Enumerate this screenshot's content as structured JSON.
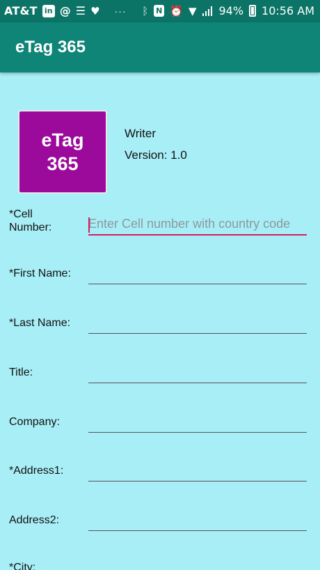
{
  "status_bar": {
    "carrier": "AT&T",
    "notification_icons": [
      "linkedin-icon",
      "at-sign-icon",
      "news-icon",
      "iheart-icon"
    ],
    "overflow": "···",
    "battery": "94%",
    "time": "10:56 AM",
    "system_icons": [
      "bluetooth-icon",
      "nfc-icon",
      "alarm-icon",
      "wifi-icon",
      "signal-icon",
      "battery-icon"
    ]
  },
  "app_bar": {
    "title": "eTag 365"
  },
  "header": {
    "logo": {
      "line1": "eTag",
      "line2": "365"
    },
    "app_name": "Writer",
    "version": "Version: 1.0"
  },
  "form": {
    "fields": [
      {
        "label_line1": "*Cell",
        "label_line2": "Number:",
        "placeholder": "Enter Cell number with country code",
        "value": ""
      },
      {
        "label": "*First Name:",
        "value": ""
      },
      {
        "label": "*Last Name:",
        "value": ""
      },
      {
        "label": "Title:",
        "value": ""
      },
      {
        "label": "Company:",
        "value": ""
      },
      {
        "label": "*Address1:",
        "value": ""
      },
      {
        "label": "Address2:",
        "value": ""
      },
      {
        "label": "*City:",
        "value": ""
      }
    ]
  },
  "colors": {
    "status_bar": "#0c7466",
    "app_bar": "#0e8577",
    "background": "#a8eef6",
    "logo": "#9b0a9b",
    "accent": "#d81b60"
  }
}
